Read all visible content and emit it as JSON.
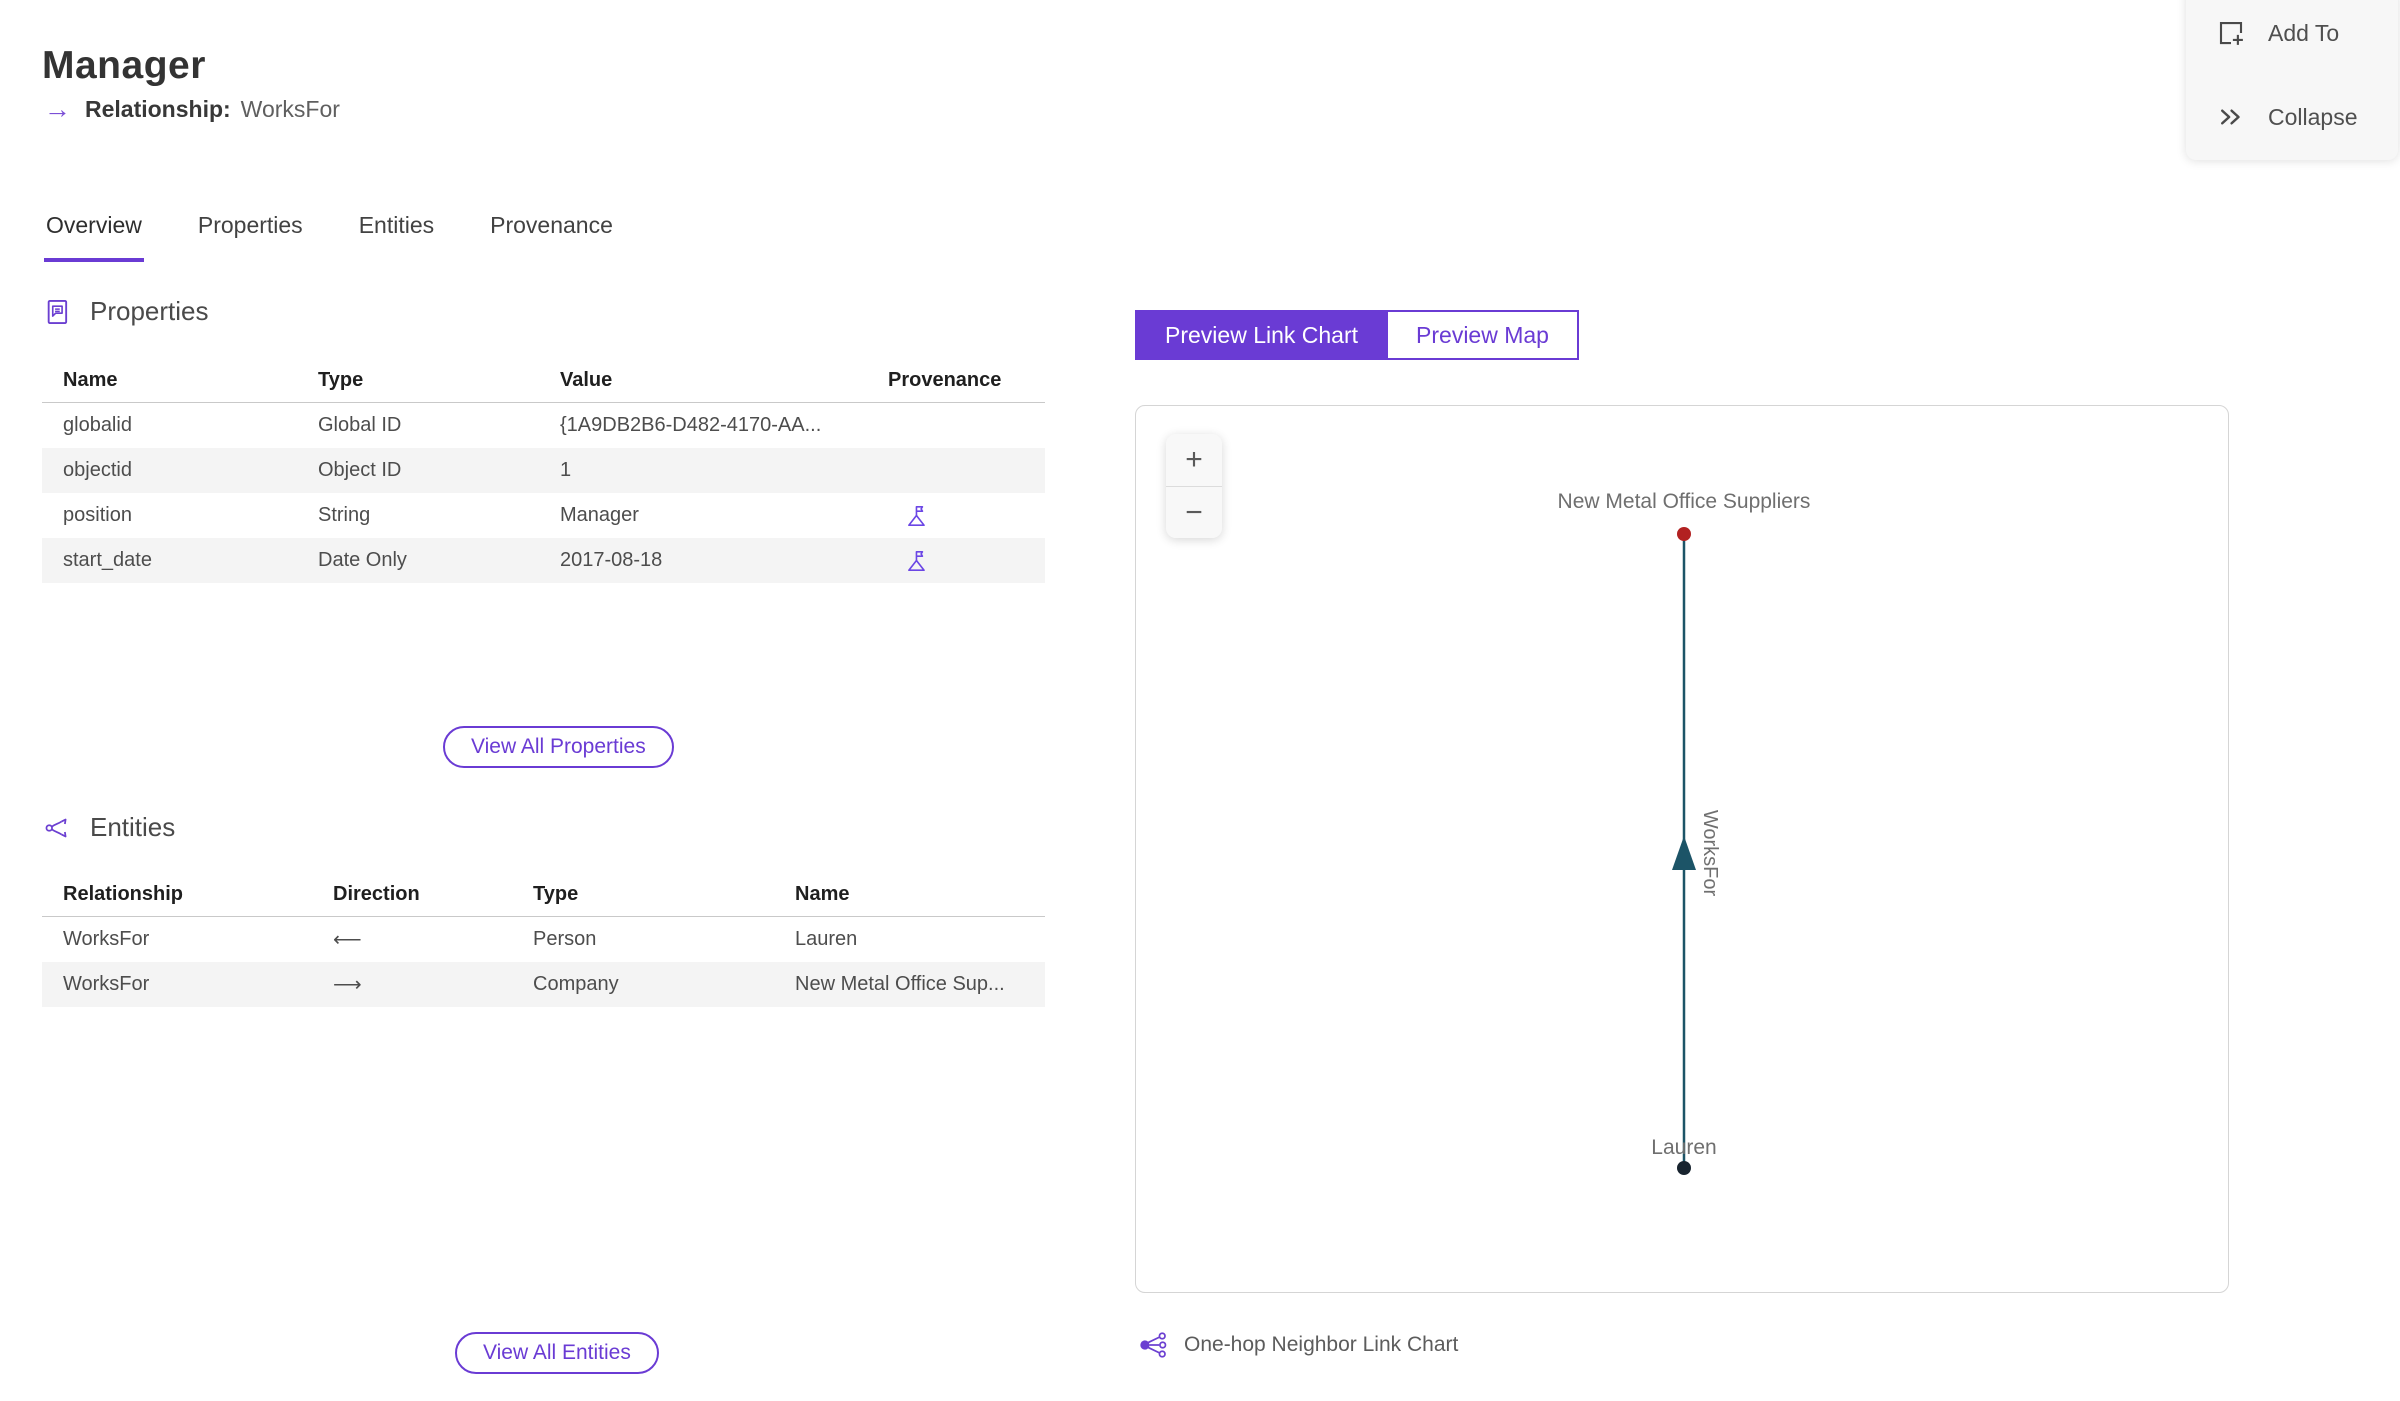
{
  "header": {
    "title": "Manager",
    "arrow_icon": "→",
    "relationship_label": "Relationship:",
    "relationship_value": "WorksFor"
  },
  "actions": {
    "add_to": "Add To",
    "collapse": "Collapse"
  },
  "tabs": [
    {
      "label": "Overview",
      "active": true
    },
    {
      "label": "Properties",
      "active": false
    },
    {
      "label": "Entities",
      "active": false
    },
    {
      "label": "Provenance",
      "active": false
    }
  ],
  "properties_section": {
    "title": "Properties",
    "columns": [
      "Name",
      "Type",
      "Value",
      "Provenance"
    ],
    "rows": [
      {
        "name": "globalid",
        "type": "Global ID",
        "value": "{1A9DB2B6-D482-4170-AA...",
        "provenance": false
      },
      {
        "name": "objectid",
        "type": "Object ID",
        "value": "1",
        "provenance": false
      },
      {
        "name": "position",
        "type": "String",
        "value": "Manager",
        "provenance": true
      },
      {
        "name": "start_date",
        "type": "Date Only",
        "value": "2017-08-18",
        "provenance": true
      }
    ],
    "view_all_label": "View All Properties"
  },
  "entities_section": {
    "title": "Entities",
    "columns": [
      "Relationship",
      "Direction",
      "Type",
      "Name"
    ],
    "rows": [
      {
        "relationship": "WorksFor",
        "direction": "⟵",
        "type": "Person",
        "name": "Lauren"
      },
      {
        "relationship": "WorksFor",
        "direction": "⟶",
        "type": "Company",
        "name": "New Metal Office Sup..."
      }
    ],
    "view_all_label": "View All Entities"
  },
  "preview": {
    "link_chart_label": "Preview Link Chart",
    "map_label": "Preview Map",
    "zoom_in": "+",
    "zoom_out": "−",
    "caption": "One-hop Neighbor Link Chart"
  },
  "chart_data": {
    "type": "link-chart",
    "nodes": [
      {
        "label": "New Metal Office Suppliers",
        "color": "#b22121",
        "position": "top"
      },
      {
        "label": "Lauren",
        "color": "#18242f",
        "position": "bottom"
      }
    ],
    "edges": [
      {
        "label": "WorksFor",
        "from": "Lauren",
        "to": "New Metal Office Suppliers",
        "direction": "up",
        "color": "#1c5467"
      }
    ]
  },
  "colors": {
    "accent": "#6a3bd4",
    "link_text": "#7b57d9",
    "edge": "#1c5467",
    "node_top": "#b22121",
    "node_bottom": "#18242f"
  }
}
